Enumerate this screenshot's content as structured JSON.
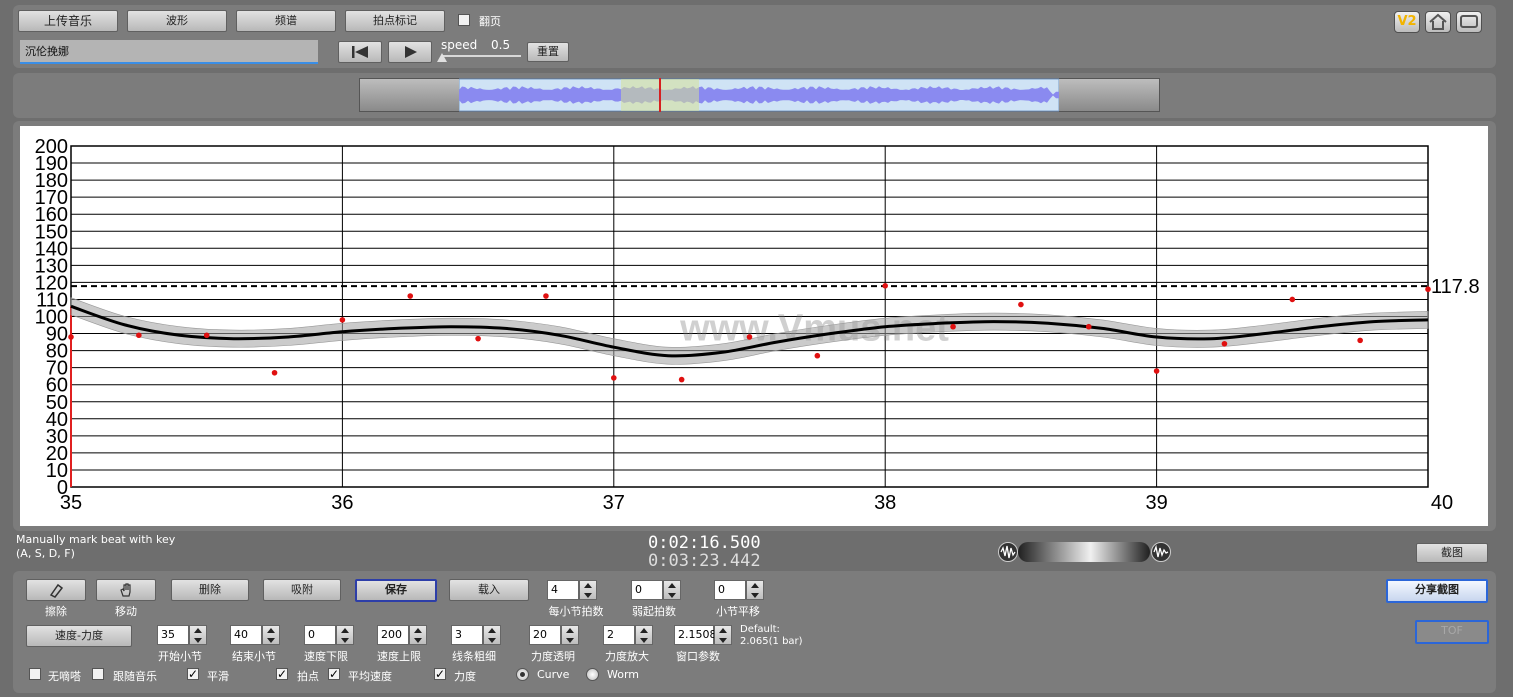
{
  "toolbar": {
    "upload_music": "上传音乐",
    "waveform": "波形",
    "spectrum": "频谱",
    "beat_mark": "拍点标记",
    "flip_page_label": "翻页",
    "track_name": "沉伦挽娜",
    "speed_label": "speed",
    "speed_value": "0.5",
    "reset": "重置",
    "version_badge": "V2"
  },
  "overview": {
    "viewport_start": 0.27,
    "viewport_end": 0.4,
    "playhead": 0.335
  },
  "chart_data": {
    "type": "line",
    "x_ticks": [
      "35",
      "36",
      "37",
      "38",
      "39",
      "40"
    ],
    "y_ticks": [
      "0",
      "10",
      "20",
      "30",
      "40",
      "50",
      "60",
      "70",
      "80",
      "90",
      "100",
      "110",
      "120",
      "130",
      "140",
      "150",
      "160",
      "170",
      "180",
      "190",
      "200"
    ],
    "xlim": [
      35,
      40
    ],
    "ylim": [
      0,
      200
    ],
    "grid": true,
    "average_value": 117.8,
    "average_label": "117.8",
    "watermark": "www.Vmus.net",
    "beat_points": [
      {
        "x": 35.0,
        "y": 88
      },
      {
        "x": 35.25,
        "y": 89
      },
      {
        "x": 35.5,
        "y": 89
      },
      {
        "x": 35.75,
        "y": 67
      },
      {
        "x": 36.0,
        "y": 98
      },
      {
        "x": 36.25,
        "y": 112
      },
      {
        "x": 36.5,
        "y": 87
      },
      {
        "x": 36.75,
        "y": 112
      },
      {
        "x": 37.0,
        "y": 64
      },
      {
        "x": 37.25,
        "y": 63
      },
      {
        "x": 37.5,
        "y": 88
      },
      {
        "x": 37.75,
        "y": 77
      },
      {
        "x": 38.0,
        "y": 118
      },
      {
        "x": 38.25,
        "y": 94
      },
      {
        "x": 38.5,
        "y": 107
      },
      {
        "x": 38.75,
        "y": 94
      },
      {
        "x": 39.0,
        "y": 68
      },
      {
        "x": 39.25,
        "y": 84
      },
      {
        "x": 39.5,
        "y": 110
      },
      {
        "x": 39.75,
        "y": 86
      },
      {
        "x": 40.0,
        "y": 116
      }
    ],
    "curve": [
      {
        "x": 35.0,
        "y": 106
      },
      {
        "x": 35.2,
        "y": 95
      },
      {
        "x": 35.4,
        "y": 89
      },
      {
        "x": 35.6,
        "y": 87
      },
      {
        "x": 35.8,
        "y": 88
      },
      {
        "x": 36.0,
        "y": 91
      },
      {
        "x": 36.2,
        "y": 93
      },
      {
        "x": 36.4,
        "y": 94
      },
      {
        "x": 36.6,
        "y": 93
      },
      {
        "x": 36.8,
        "y": 89
      },
      {
        "x": 37.0,
        "y": 82
      },
      {
        "x": 37.2,
        "y": 77
      },
      {
        "x": 37.4,
        "y": 79
      },
      {
        "x": 37.6,
        "y": 85
      },
      {
        "x": 37.8,
        "y": 90
      },
      {
        "x": 38.0,
        "y": 94
      },
      {
        "x": 38.2,
        "y": 96
      },
      {
        "x": 38.4,
        "y": 97
      },
      {
        "x": 38.6,
        "y": 96
      },
      {
        "x": 38.8,
        "y": 93
      },
      {
        "x": 39.0,
        "y": 88
      },
      {
        "x": 39.2,
        "y": 87
      },
      {
        "x": 39.4,
        "y": 90
      },
      {
        "x": 39.6,
        "y": 94
      },
      {
        "x": 39.8,
        "y": 97
      },
      {
        "x": 40.0,
        "y": 98
      }
    ],
    "band_halfwidth": 5
  },
  "status": {
    "hint_line1": "Manually mark beat with key",
    "hint_line2": "(A, S, D, F)",
    "current_time": "0:02:16.500",
    "total_time": "0:03:23.442",
    "screenshot": "截图"
  },
  "controls": {
    "eraser_label": "擦除",
    "move_label": "移动",
    "delete": "删除",
    "snap": "吸附",
    "save": "保存",
    "load": "载入",
    "beats_per_bar_value": "4",
    "beats_per_bar_label": "每小节拍数",
    "pickup_value": "0",
    "pickup_label": "弱起拍数",
    "bar_offset_value": "0",
    "bar_offset_label": "小节平移",
    "share_screenshot": "分享截图",
    "mode_button": "速度-力度",
    "start_bar_value": "35",
    "start_bar_label": "开始小节",
    "end_bar_value": "40",
    "end_bar_label": "结束小节",
    "tempo_min_value": "0",
    "tempo_min_label": "速度下限",
    "tempo_max_value": "200",
    "tempo_max_label": "速度上限",
    "line_width_value": "3",
    "line_width_label": "线条粗细",
    "dyn_opacity_value": "20",
    "dyn_opacity_label": "力度透明",
    "dyn_scale_value": "2",
    "dyn_scale_label": "力度放大",
    "window_value": "2.1508",
    "window_label": "窗口参数",
    "default_line1": "Default:",
    "default_line2": "2.065(1 bar)",
    "mute_label": "无嘀嗒",
    "follow_label": "跟随音乐",
    "smooth_label": "平滑",
    "beats_label": "拍点",
    "avg_tempo_label": "平均速度",
    "dynamics_label": "力度",
    "curve_label": "Curve",
    "worm_label": "Worm",
    "tof": "TOF"
  }
}
